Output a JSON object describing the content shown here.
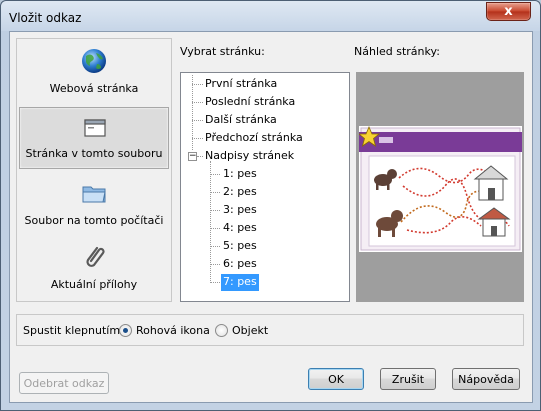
{
  "window": {
    "title": "Vložit odkaz",
    "close_glyph": "x"
  },
  "nav": {
    "items": [
      {
        "label": "Webová stránka",
        "icon": "globe-icon"
      },
      {
        "label": "Stránka v tomto souboru",
        "icon": "page-icon",
        "selected": true
      },
      {
        "label": "Soubor na tomto počítači",
        "icon": "folder-icon"
      },
      {
        "label": "Aktuální přílohy",
        "icon": "paperclip-icon"
      }
    ]
  },
  "tree": {
    "header": "Vybrat stránku:",
    "items": [
      {
        "label": "První stránka"
      },
      {
        "label": "Poslední stránka"
      },
      {
        "label": "Další stránka"
      },
      {
        "label": "Předchozí stránka"
      },
      {
        "label": "Nadpisy stránek",
        "expander": "−"
      },
      {
        "label": "1: pes"
      },
      {
        "label": "2: pes"
      },
      {
        "label": "3: pes"
      },
      {
        "label": "4: pes"
      },
      {
        "label": "5: pes"
      },
      {
        "label": "6: pes"
      },
      {
        "label": "7: pes",
        "selected": true
      }
    ]
  },
  "preview": {
    "header": "Náhled stránky:"
  },
  "activation": {
    "label": "Spustit klepnutím:",
    "options": [
      {
        "label": "Rohová ikona",
        "checked": true
      },
      {
        "label": "Objekt",
        "checked": false
      }
    ]
  },
  "buttons": {
    "remove": "Odebrat odkaz",
    "ok": "OK",
    "cancel": "Zrušit",
    "help": "Nápověda"
  },
  "colors": {
    "selection": "#3399ff",
    "preview_banner": "#7a3b97",
    "preview_bg": "#9e9e9e"
  }
}
